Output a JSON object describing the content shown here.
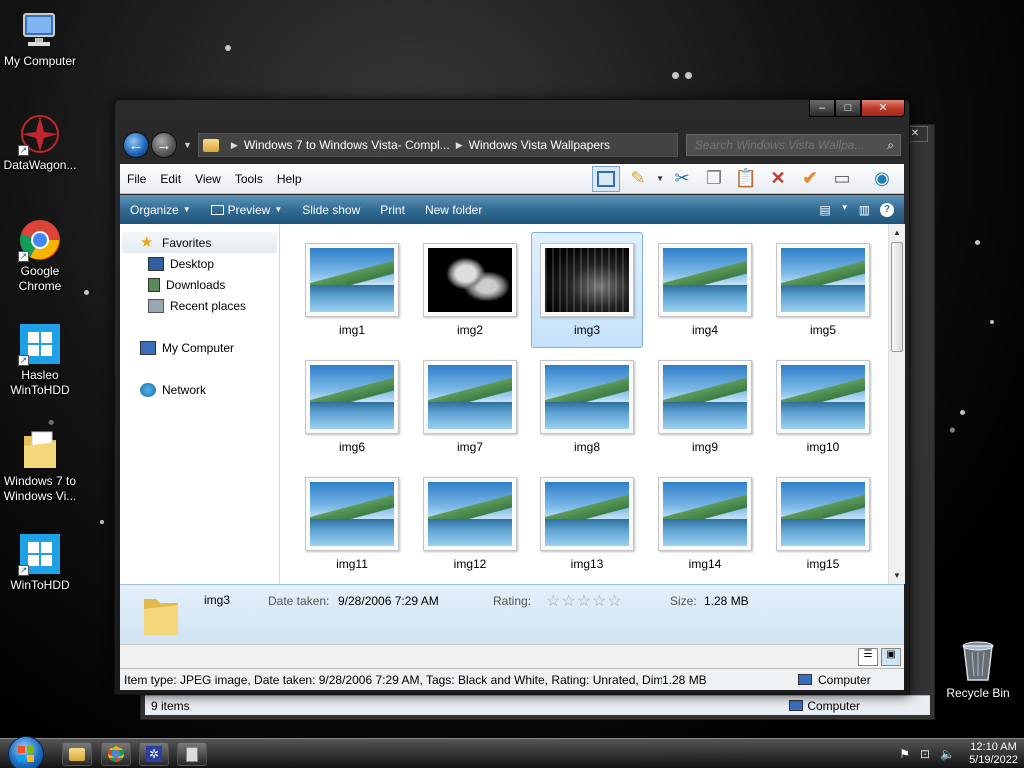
{
  "desktop": {
    "icons": [
      {
        "label": "My Computer"
      },
      {
        "label": "DataWagon..."
      },
      {
        "label": "Google Chrome"
      },
      {
        "label": "Hasleo WinToHDD"
      },
      {
        "label": "Windows 7 to Windows Vi..."
      },
      {
        "label": "WinToHDD"
      }
    ],
    "recycle_bin": "Recycle Bin"
  },
  "back_window": {
    "status_items": "9 items",
    "status_location": "Computer"
  },
  "window": {
    "breadcrumb": [
      "Windows 7 to Windows Vista- Compl...",
      "Windows Vista Wallpapers"
    ],
    "search_placeholder": "Search Windows Vista Wallpa...",
    "menu": [
      "File",
      "Edit",
      "View",
      "Tools",
      "Help"
    ],
    "commands": {
      "organize": "Organize",
      "preview": "Preview",
      "slideshow": "Slide show",
      "print": "Print",
      "new_folder": "New folder"
    },
    "nav": {
      "favorites": "Favorites",
      "desktop": "Desktop",
      "downloads": "Downloads",
      "recent": "Recent places",
      "computer": "My Computer",
      "network": "Network"
    },
    "files": [
      {
        "name": "img1",
        "kind": "vista"
      },
      {
        "name": "img2",
        "kind": "leaf"
      },
      {
        "name": "img3",
        "kind": "city",
        "selected": true
      },
      {
        "name": "img4",
        "kind": "vista"
      },
      {
        "name": "img5",
        "kind": "vista"
      },
      {
        "name": "img6",
        "kind": "vista"
      },
      {
        "name": "img7",
        "kind": "vista"
      },
      {
        "name": "img8",
        "kind": "vista"
      },
      {
        "name": "img9",
        "kind": "vista"
      },
      {
        "name": "img10",
        "kind": "vista"
      },
      {
        "name": "img11",
        "kind": "vista"
      },
      {
        "name": "img12",
        "kind": "vista"
      },
      {
        "name": "img13",
        "kind": "vista"
      },
      {
        "name": "img14",
        "kind": "vista"
      },
      {
        "name": "img15",
        "kind": "vista"
      }
    ],
    "details": {
      "name": "img3",
      "date_label": "Date taken:",
      "date_value": "9/28/2006 7:29 AM",
      "rating_label": "Rating:",
      "rating_stars": "☆☆☆☆☆",
      "size_label": "Size:",
      "size_value": "1.28 MB"
    },
    "status": {
      "info": "Item type: JPEG image, Date taken: 9/28/2006 7:29 AM, Tags: Black and White, Rating: Unrated, Dimensi",
      "size": "1.28 MB",
      "location": "Computer"
    }
  },
  "taskbar": {
    "time": "12:10 AM",
    "date": "5/19/2022"
  },
  "colors": {
    "accent": "#336b93",
    "selection": "#c5e2fa",
    "close": "#c0392b"
  }
}
